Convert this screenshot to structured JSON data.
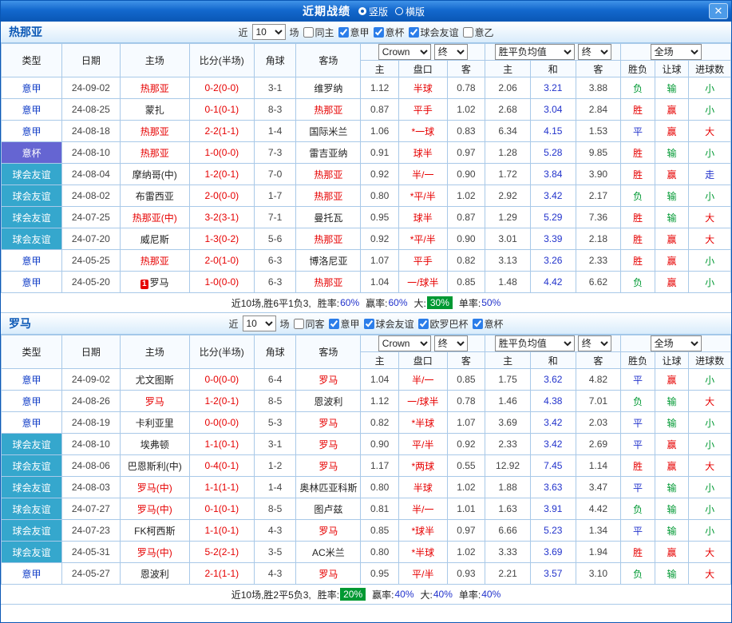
{
  "window": {
    "title": "近期战绩",
    "view_options": [
      {
        "label": "竖版",
        "selected": true
      },
      {
        "label": "横版",
        "selected": false
      }
    ],
    "close_glyph": "✕"
  },
  "palette": {
    "focal_team": "#e60000",
    "team_normal": "#222222",
    "score": "#e60000",
    "handicap": "#e60000",
    "dim_text": "#444444",
    "draw_odds": "#2233cc",
    "stat_value": "#2233cc",
    "highlight_bg": "#009933",
    "highlight_text": "#ffffff",
    "badge_bg": "#e60000",
    "badge_text": "#ffffff"
  },
  "type_styles": {
    "意甲": {
      "bg": "#ffffff",
      "color": "#1540c8"
    },
    "意杯": {
      "bg": "#6565d2",
      "color": "#ffffff"
    },
    "球会友谊": {
      "bg": "#35a7cd",
      "color": "#ffffff"
    }
  },
  "result_colors": {
    "胜": "#e60000",
    "平": "#2233cc",
    "负": "#009933",
    "赢": "#e60000",
    "输": "#009933",
    "走": "#2233cc",
    "大": "#e60000",
    "小": "#009933"
  },
  "sections": [
    {
      "team": "热那亚",
      "filter": {
        "near_label": "近",
        "games_value": "10",
        "games_label": "场",
        "checkboxes": [
          {
            "label": "同主",
            "checked": false
          },
          {
            "label": "意甲",
            "checked": true
          },
          {
            "label": "意杯",
            "checked": true
          },
          {
            "label": "球会友谊",
            "checked": true
          },
          {
            "label": "意乙",
            "checked": false
          }
        ]
      },
      "header": {
        "cols": [
          "类型",
          "日期",
          "主场",
          "比分(半场)",
          "角球",
          "客场"
        ],
        "provider_select": "Crown",
        "provider_state": "终",
        "europe_select": "胜平负均值",
        "europe_state": "终",
        "scope_select": "全场",
        "sub_cols": [
          "主",
          "盘口",
          "客",
          "主",
          "和",
          "客",
          "胜负",
          "让球",
          "进球数"
        ]
      },
      "rows": [
        {
          "type": "意甲",
          "date": "24-09-02",
          "home": "热那亚",
          "home_focal": true,
          "home_badge": "",
          "score": "0-2(0-0)",
          "corners": "3-1",
          "away": "维罗纳",
          "away_focal": false,
          "water_home": "1.12",
          "handicap": "半球",
          "water_away": "0.78",
          "odds_home": "2.06",
          "odds_draw": "3.21",
          "odds_away": "3.88",
          "result": "负",
          "handicap_result": "输",
          "goals_result": "小"
        },
        {
          "type": "意甲",
          "date": "24-08-25",
          "home": "蒙扎",
          "home_focal": false,
          "home_badge": "",
          "score": "0-1(0-1)",
          "corners": "8-3",
          "away": "热那亚",
          "away_focal": true,
          "water_home": "0.87",
          "handicap": "平手",
          "water_away": "1.02",
          "odds_home": "2.68",
          "odds_draw": "3.04",
          "odds_away": "2.84",
          "result": "胜",
          "handicap_result": "赢",
          "goals_result": "小"
        },
        {
          "type": "意甲",
          "date": "24-08-18",
          "home": "热那亚",
          "home_focal": true,
          "home_badge": "",
          "score": "2-2(1-1)",
          "corners": "1-4",
          "away": "国际米兰",
          "away_focal": false,
          "water_home": "1.06",
          "handicap": "*一球",
          "water_away": "0.83",
          "odds_home": "6.34",
          "odds_draw": "4.15",
          "odds_away": "1.53",
          "result": "平",
          "handicap_result": "赢",
          "goals_result": "大"
        },
        {
          "type": "意杯",
          "date": "24-08-10",
          "home": "热那亚",
          "home_focal": true,
          "home_badge": "",
          "score": "1-0(0-0)",
          "corners": "7-3",
          "away": "雷吉亚纳",
          "away_focal": false,
          "water_home": "0.91",
          "handicap": "球半",
          "water_away": "0.97",
          "odds_home": "1.28",
          "odds_draw": "5.28",
          "odds_away": "9.85",
          "result": "胜",
          "handicap_result": "输",
          "goals_result": "小"
        },
        {
          "type": "球会友谊",
          "date": "24-08-04",
          "home": "摩纳哥(中)",
          "home_focal": false,
          "home_badge": "",
          "score": "1-2(0-1)",
          "corners": "7-0",
          "away": "热那亚",
          "away_focal": true,
          "water_home": "0.92",
          "handicap": "半/一",
          "water_away": "0.90",
          "odds_home": "1.72",
          "odds_draw": "3.84",
          "odds_away": "3.90",
          "result": "胜",
          "handicap_result": "赢",
          "goals_result": "走"
        },
        {
          "type": "球会友谊",
          "date": "24-08-02",
          "home": "布雷西亚",
          "home_focal": false,
          "home_badge": "",
          "score": "2-0(0-0)",
          "corners": "1-7",
          "away": "热那亚",
          "away_focal": true,
          "water_home": "0.80",
          "handicap": "*平/半",
          "water_away": "1.02",
          "odds_home": "2.92",
          "odds_draw": "3.42",
          "odds_away": "2.17",
          "result": "负",
          "handicap_result": "输",
          "goals_result": "小"
        },
        {
          "type": "球会友谊",
          "date": "24-07-25",
          "home": "热那亚(中)",
          "home_focal": true,
          "home_badge": "",
          "score": "3-2(3-1)",
          "corners": "7-1",
          "away": "曼托瓦",
          "away_focal": false,
          "water_home": "0.95",
          "handicap": "球半",
          "water_away": "0.87",
          "odds_home": "1.29",
          "odds_draw": "5.29",
          "odds_away": "7.36",
          "result": "胜",
          "handicap_result": "输",
          "goals_result": "大"
        },
        {
          "type": "球会友谊",
          "date": "24-07-20",
          "home": "威尼斯",
          "home_focal": false,
          "home_badge": "",
          "score": "1-3(0-2)",
          "corners": "5-6",
          "away": "热那亚",
          "away_focal": true,
          "water_home": "0.92",
          "handicap": "*平/半",
          "water_away": "0.90",
          "odds_home": "3.01",
          "odds_draw": "3.39",
          "odds_away": "2.18",
          "result": "胜",
          "handicap_result": "赢",
          "goals_result": "大"
        },
        {
          "type": "意甲",
          "date": "24-05-25",
          "home": "热那亚",
          "home_focal": true,
          "home_badge": "",
          "score": "2-0(1-0)",
          "corners": "6-3",
          "away": "博洛尼亚",
          "away_focal": false,
          "water_home": "1.07",
          "handicap": "平手",
          "water_away": "0.82",
          "odds_home": "3.13",
          "odds_draw": "3.26",
          "odds_away": "2.33",
          "result": "胜",
          "handicap_result": "赢",
          "goals_result": "小"
        },
        {
          "type": "意甲",
          "date": "24-05-20",
          "home": "罗马",
          "home_focal": false,
          "home_badge": "1",
          "score": "1-0(0-0)",
          "corners": "6-3",
          "away": "热那亚",
          "away_focal": true,
          "water_home": "1.04",
          "handicap": "一/球半",
          "water_away": "0.85",
          "odds_home": "1.48",
          "odds_draw": "4.42",
          "odds_away": "6.62",
          "result": "负",
          "handicap_result": "赢",
          "goals_result": "小"
        }
      ],
      "summary": {
        "prefix": "近10场,胜6平1负3,",
        "stats": [
          {
            "label": "胜率:",
            "value": "60%",
            "highlight": false
          },
          {
            "label": "赢率:",
            "value": "60%",
            "highlight": false
          },
          {
            "label": "大:",
            "value": "30%",
            "highlight": true
          },
          {
            "label": "单率:",
            "value": "50%",
            "highlight": false
          }
        ]
      }
    },
    {
      "team": "罗马",
      "filter": {
        "near_label": "近",
        "games_value": "10",
        "games_label": "场",
        "checkboxes": [
          {
            "label": "同客",
            "checked": false
          },
          {
            "label": "意甲",
            "checked": true
          },
          {
            "label": "球会友谊",
            "checked": true
          },
          {
            "label": "欧罗巴杯",
            "checked": true
          },
          {
            "label": "意杯",
            "checked": true
          }
        ]
      },
      "header": {
        "cols": [
          "类型",
          "日期",
          "主场",
          "比分(半场)",
          "角球",
          "客场"
        ],
        "provider_select": "Crown",
        "provider_state": "终",
        "europe_select": "胜平负均值",
        "europe_state": "终",
        "scope_select": "全场",
        "sub_cols": [
          "主",
          "盘口",
          "客",
          "主",
          "和",
          "客",
          "胜负",
          "让球",
          "进球数"
        ]
      },
      "rows": [
        {
          "type": "意甲",
          "date": "24-09-02",
          "home": "尤文图斯",
          "home_focal": false,
          "home_badge": "",
          "score": "0-0(0-0)",
          "corners": "6-4",
          "away": "罗马",
          "away_focal": true,
          "water_home": "1.04",
          "handicap": "半/一",
          "water_away": "0.85",
          "odds_home": "1.75",
          "odds_draw": "3.62",
          "odds_away": "4.82",
          "result": "平",
          "handicap_result": "赢",
          "goals_result": "小"
        },
        {
          "type": "意甲",
          "date": "24-08-26",
          "home": "罗马",
          "home_focal": true,
          "home_badge": "",
          "score": "1-2(0-1)",
          "corners": "8-5",
          "away": "恩波利",
          "away_focal": false,
          "water_home": "1.12",
          "handicap": "一/球半",
          "water_away": "0.78",
          "odds_home": "1.46",
          "odds_draw": "4.38",
          "odds_away": "7.01",
          "result": "负",
          "handicap_result": "输",
          "goals_result": "大"
        },
        {
          "type": "意甲",
          "date": "24-08-19",
          "home": "卡利亚里",
          "home_focal": false,
          "home_badge": "",
          "score": "0-0(0-0)",
          "corners": "5-3",
          "away": "罗马",
          "away_focal": true,
          "water_home": "0.82",
          "handicap": "*半球",
          "water_away": "1.07",
          "odds_home": "3.69",
          "odds_draw": "3.42",
          "odds_away": "2.03",
          "result": "平",
          "handicap_result": "输",
          "goals_result": "小"
        },
        {
          "type": "球会友谊",
          "date": "24-08-10",
          "home": "埃弗顿",
          "home_focal": false,
          "home_badge": "",
          "score": "1-1(0-1)",
          "corners": "3-1",
          "away": "罗马",
          "away_focal": true,
          "water_home": "0.90",
          "handicap": "平/半",
          "water_away": "0.92",
          "odds_home": "2.33",
          "odds_draw": "3.42",
          "odds_away": "2.69",
          "result": "平",
          "handicap_result": "赢",
          "goals_result": "小"
        },
        {
          "type": "球会友谊",
          "date": "24-08-06",
          "home": "巴恩斯利(中)",
          "home_focal": false,
          "home_badge": "",
          "score": "0-4(0-1)",
          "corners": "1-2",
          "away": "罗马",
          "away_focal": true,
          "water_home": "1.17",
          "handicap": "*两球",
          "water_away": "0.55",
          "odds_home": "12.92",
          "odds_draw": "7.45",
          "odds_away": "1.14",
          "result": "胜",
          "handicap_result": "赢",
          "goals_result": "大"
        },
        {
          "type": "球会友谊",
          "date": "24-08-03",
          "home": "罗马(中)",
          "home_focal": true,
          "home_badge": "",
          "score": "1-1(1-1)",
          "corners": "1-4",
          "away": "奥林匹亚科斯",
          "away_focal": false,
          "water_home": "0.80",
          "handicap": "半球",
          "water_away": "1.02",
          "odds_home": "1.88",
          "odds_draw": "3.63",
          "odds_away": "3.47",
          "result": "平",
          "handicap_result": "输",
          "goals_result": "小"
        },
        {
          "type": "球会友谊",
          "date": "24-07-27",
          "home": "罗马(中)",
          "home_focal": true,
          "home_badge": "",
          "score": "0-1(0-1)",
          "corners": "8-5",
          "away": "图卢兹",
          "away_focal": false,
          "water_home": "0.81",
          "handicap": "半/一",
          "water_away": "1.01",
          "odds_home": "1.63",
          "odds_draw": "3.91",
          "odds_away": "4.42",
          "result": "负",
          "handicap_result": "输",
          "goals_result": "小"
        },
        {
          "type": "球会友谊",
          "date": "24-07-23",
          "home": "FK柯西斯",
          "home_focal": false,
          "home_badge": "",
          "score": "1-1(0-1)",
          "corners": "4-3",
          "away": "罗马",
          "away_focal": true,
          "water_home": "0.85",
          "handicap": "*球半",
          "water_away": "0.97",
          "odds_home": "6.66",
          "odds_draw": "5.23",
          "odds_away": "1.34",
          "result": "平",
          "handicap_result": "输",
          "goals_result": "小"
        },
        {
          "type": "球会友谊",
          "date": "24-05-31",
          "home": "罗马(中)",
          "home_focal": true,
          "home_badge": "",
          "score": "5-2(2-1)",
          "corners": "3-5",
          "away": "AC米兰",
          "away_focal": false,
          "water_home": "0.80",
          "handicap": "*半球",
          "water_away": "1.02",
          "odds_home": "3.33",
          "odds_draw": "3.69",
          "odds_away": "1.94",
          "result": "胜",
          "handicap_result": "赢",
          "goals_result": "大"
        },
        {
          "type": "意甲",
          "date": "24-05-27",
          "home": "恩波利",
          "home_focal": false,
          "home_badge": "",
          "score": "2-1(1-1)",
          "corners": "4-3",
          "away": "罗马",
          "away_focal": true,
          "water_home": "0.95",
          "handicap": "平/半",
          "water_away": "0.93",
          "odds_home": "2.21",
          "odds_draw": "3.57",
          "odds_away": "3.10",
          "result": "负",
          "handicap_result": "输",
          "goals_result": "大"
        }
      ],
      "summary": {
        "prefix": "近10场,胜2平5负3,",
        "stats": [
          {
            "label": "胜率:",
            "value": "20%",
            "highlight": true
          },
          {
            "label": "赢率:",
            "value": "40%",
            "highlight": false
          },
          {
            "label": "大:",
            "value": "40%",
            "highlight": false
          },
          {
            "label": "单率:",
            "value": "40%",
            "highlight": false
          }
        ]
      }
    }
  ]
}
